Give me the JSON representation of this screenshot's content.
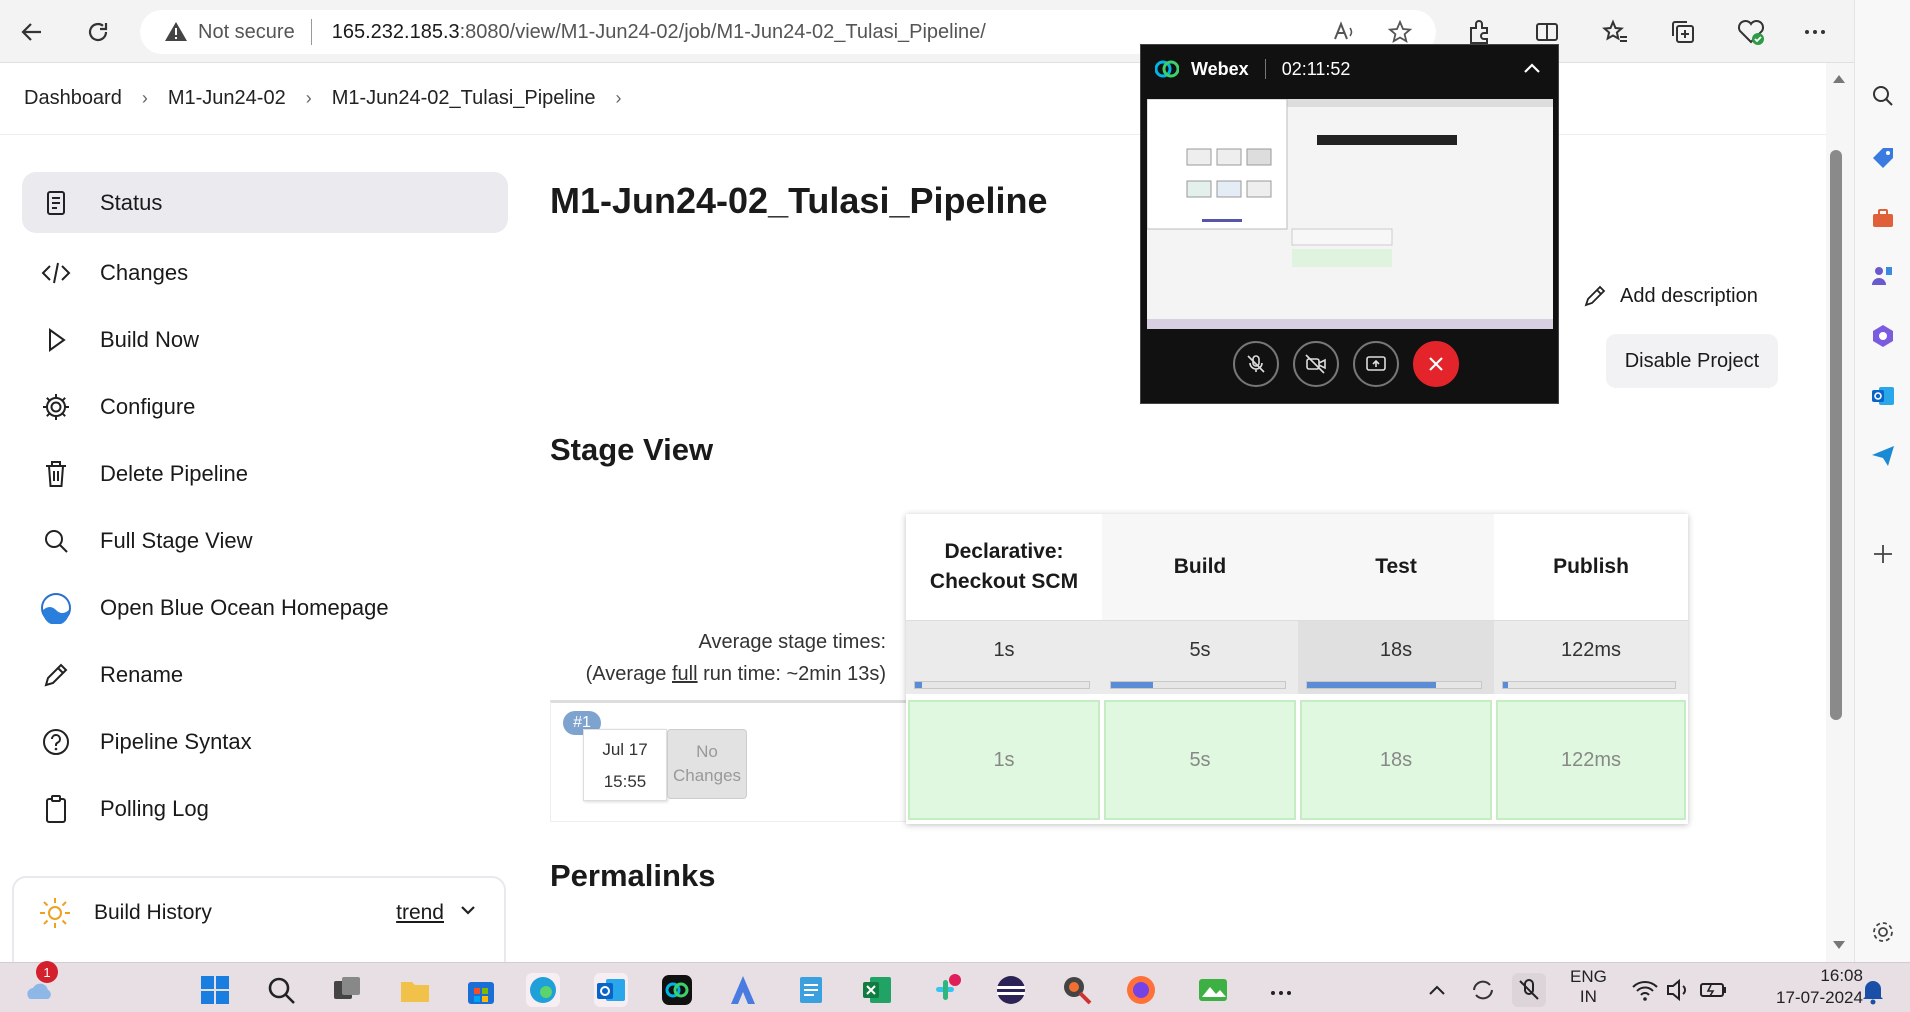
{
  "browser": {
    "not_secure": "Not secure",
    "host": "165.232.185.3",
    "path": ":8080/view/M1-Jun24-02/job/M1-Jun24-02_Tulasi_Pipeline/"
  },
  "breadcrumb": [
    "Dashboard",
    "M1-Jun24-02",
    "M1-Jun24-02_Tulasi_Pipeline"
  ],
  "sidebar": {
    "items": [
      {
        "label": "Status",
        "icon": "document-icon"
      },
      {
        "label": "Changes",
        "icon": "code-icon"
      },
      {
        "label": "Build Now",
        "icon": "play-icon"
      },
      {
        "label": "Configure",
        "icon": "gear-icon"
      },
      {
        "label": "Delete Pipeline",
        "icon": "trash-icon"
      },
      {
        "label": "Full Stage View",
        "icon": "search-icon"
      },
      {
        "label": "Open Blue Ocean Homepage",
        "icon": "blue-ocean-icon"
      },
      {
        "label": "Rename",
        "icon": "pencil-icon"
      },
      {
        "label": "Pipeline Syntax",
        "icon": "help-icon"
      },
      {
        "label": "Polling Log",
        "icon": "clipboard-icon"
      }
    ],
    "build_history": {
      "label": "Build History",
      "trend": "trend"
    }
  },
  "main": {
    "title": "M1-Jun24-02_Tulasi_Pipeline",
    "add_description": "Add description",
    "disable_project": "Disable Project",
    "stage_view_heading": "Stage View",
    "permalinks_heading": "Permalinks"
  },
  "stage_view": {
    "avg_label_1": "Average stage times:",
    "avg_label_2a": "(Average ",
    "avg_label_2b": "full",
    "avg_label_2c": " run time: ~2min 13s)",
    "stages": [
      {
        "name_1": "Declarative:",
        "name_2": "Checkout SCM",
        "avg": "1s",
        "run": "1s",
        "bar_fraction": 0.04
      },
      {
        "name_1": "Build",
        "name_2": "",
        "avg": "5s",
        "run": "5s",
        "bar_fraction": 0.24
      },
      {
        "name_1": "Test",
        "name_2": "",
        "avg": "18s",
        "run": "18s",
        "bar_fraction": 0.74
      },
      {
        "name_1": "Publish",
        "name_2": "",
        "avg": "122ms",
        "run": "122ms",
        "bar_fraction": 0.01
      }
    ],
    "run": {
      "number": "#1",
      "date": "Jul 17",
      "time": "15:55",
      "changes_1": "No",
      "changes_2": "Changes"
    }
  },
  "webex": {
    "app": "Webex",
    "timer": "02:11:52"
  },
  "taskbar": {
    "notification_count": "1",
    "lang_1": "ENG",
    "lang_2": "IN",
    "clock_time": "16:08",
    "clock_date": "17-07-2024"
  },
  "colors": {
    "accent": "#5b8dd6",
    "success_bg": "#e0f8df",
    "webex_end": "#e3242b"
  }
}
